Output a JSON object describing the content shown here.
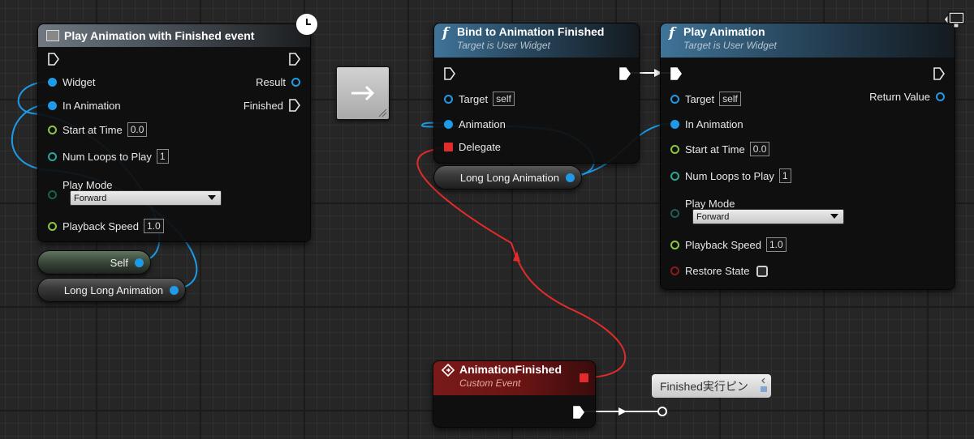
{
  "nodes": {
    "play_anim_event": {
      "title": "Play Animation with Finished event",
      "pins": {
        "widget": "Widget",
        "in_animation": "In Animation",
        "start_at_time": "Start at Time",
        "start_at_time_value": "0.0",
        "num_loops": "Num Loops to Play",
        "num_loops_value": "1",
        "play_mode": "Play Mode",
        "play_mode_value": "Forward",
        "playback_speed": "Playback Speed",
        "playback_speed_value": "1.0",
        "result": "Result",
        "finished": "Finished"
      }
    },
    "bind_anim": {
      "title": "Bind to Animation Finished",
      "subtitle": "Target is User Widget",
      "pins": {
        "target": "Target",
        "target_value": "self",
        "animation": "Animation",
        "delegate": "Delegate"
      }
    },
    "play_anim": {
      "title": "Play Animation",
      "subtitle": "Target is User Widget",
      "pins": {
        "target": "Target",
        "target_value": "self",
        "in_animation": "In Animation",
        "start_at_time": "Start at Time",
        "start_at_time_value": "0.0",
        "num_loops": "Num Loops to Play",
        "num_loops_value": "1",
        "play_mode": "Play Mode",
        "play_mode_value": "Forward",
        "playback_speed": "Playback Speed",
        "playback_speed_value": "1.0",
        "restore_state": "Restore State",
        "return_value": "Return Value"
      }
    },
    "event": {
      "title": "AnimationFinished",
      "subtitle": "Custom Event"
    }
  },
  "variables": {
    "self": "Self",
    "long_anim_left": "Long Long Animation",
    "long_anim_mid": "Long Long Animation"
  },
  "comment": "Finished実行ピン",
  "colors": {
    "exec": "#ffffff",
    "object": "#1e9ae6",
    "float": "#8cc63f",
    "int": "#2aa797",
    "delegate": "#e22b2b",
    "function_header": "#3f7499",
    "event_header": "#7a1a1a"
  }
}
